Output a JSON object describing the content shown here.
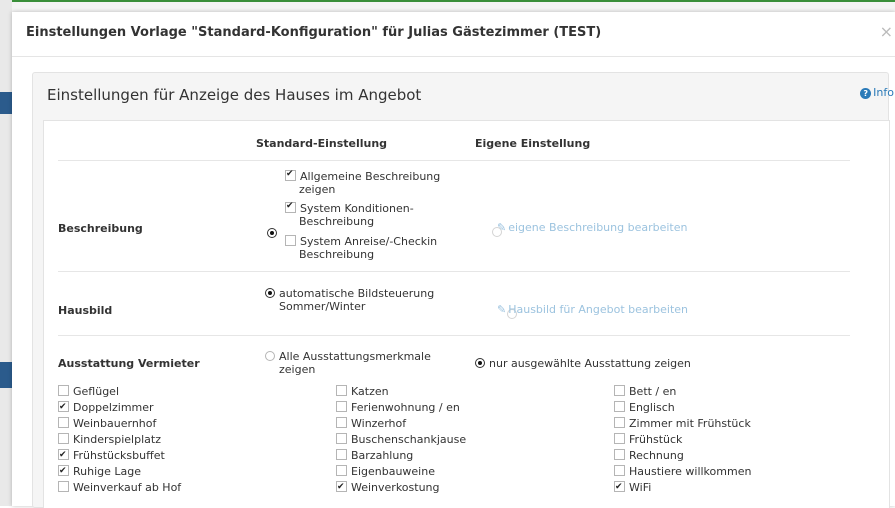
{
  "modal": {
    "title": "Einstellungen Vorlage \"Standard-Konfiguration\" für Julias Gästezimmer (TEST)",
    "close": "×"
  },
  "panel": {
    "title": "Einstellungen für Anzeige des Hauses im Angebot",
    "info_label": "Info",
    "info_icon": "question-circle-icon"
  },
  "table": {
    "col_standard": "Standard-Einstellung",
    "col_eigene": "Eigene Einstellung"
  },
  "beschreibung": {
    "label": "Beschreibung",
    "options": [
      {
        "line1": "Allgemeine Beschreibung",
        "line2": "zeigen",
        "checked": true
      },
      {
        "line1": "System Konditionen-",
        "line2": "Beschreibung",
        "checked": true
      },
      {
        "line1": "System Anreise/-Checkin",
        "line2": "Beschreibung",
        "checked": false
      }
    ],
    "standard_selected": true,
    "custom_link": "eigene Beschreibung bearbeiten"
  },
  "hausbild": {
    "label": "Hausbild",
    "standard_line1": "automatische Bildsteuerung",
    "standard_line2": "Sommer/Winter",
    "standard_selected": true,
    "custom_link": "Hausbild für Angebot bearbeiten"
  },
  "ausstattung": {
    "label": "Ausstattung Vermieter",
    "option_all_line1": "Alle Ausstattungsmerkmale",
    "option_all_line2": "zeigen",
    "option_all_selected": false,
    "option_selected_label": "nur ausgewählte Ausstattung zeigen",
    "option_selected_selected": true,
    "col1": [
      {
        "label": "Geflügel",
        "checked": false
      },
      {
        "label": "Doppelzimmer",
        "checked": true
      },
      {
        "label": "Weinbauernhof",
        "checked": false
      },
      {
        "label": "Kinderspielplatz",
        "checked": false
      },
      {
        "label": "Frühstücksbuffet",
        "checked": true
      },
      {
        "label": "Ruhige Lage",
        "checked": true
      },
      {
        "label": "Weinverkauf ab Hof",
        "checked": false
      }
    ],
    "col2": [
      {
        "label": "Katzen",
        "checked": false
      },
      {
        "label": "Ferienwohnung / en",
        "checked": false
      },
      {
        "label": "Winzerhof",
        "checked": false
      },
      {
        "label": "Buschenschankjause",
        "checked": false
      },
      {
        "label": "Barzahlung",
        "checked": false
      },
      {
        "label": "Eigenbauweine",
        "checked": false
      },
      {
        "label": "Weinverkostung",
        "checked": true
      }
    ],
    "col3": [
      {
        "label": "Bett / en",
        "checked": false
      },
      {
        "label": "Englisch",
        "checked": false
      },
      {
        "label": "Zimmer mit Frühstück",
        "checked": false
      },
      {
        "label": "Frühstück",
        "checked": false
      },
      {
        "label": "Rechnung",
        "checked": false
      },
      {
        "label": "Haustiere willkommen",
        "checked": false
      },
      {
        "label": "WiFi",
        "checked": true
      }
    ]
  },
  "colors": {
    "accent_top": "#3a8f3a",
    "link": "#2a7ab8",
    "link_disabled": "#9cc3df"
  }
}
